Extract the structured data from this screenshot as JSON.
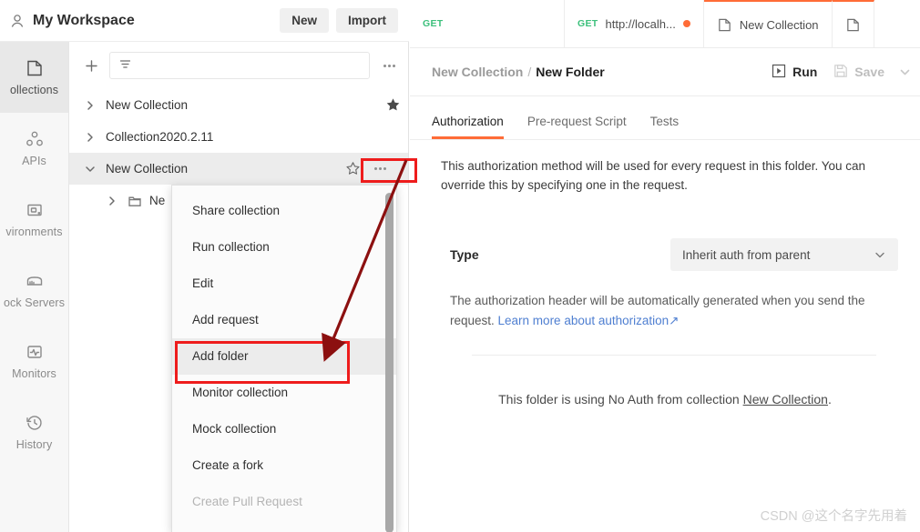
{
  "colors": {
    "accent": "#ff6c37",
    "verb_get": "#3dc07c",
    "annotation_red": "#ee1c1c",
    "arrow_dark_red": "#8c1010",
    "link_blue": "#4f7fd1"
  },
  "workspace_header": {
    "avatar_icon": "user-icon",
    "title": "My Workspace",
    "new_label": "New",
    "import_label": "Import"
  },
  "rail": {
    "items": [
      {
        "label": "ollections",
        "icon": "collections-icon",
        "active": true
      },
      {
        "label": "APIs",
        "icon": "apis-icon",
        "active": false
      },
      {
        "label": "vironments",
        "icon": "environments-icon",
        "active": false
      },
      {
        "label": "ock Servers",
        "icon": "mock-servers-icon",
        "active": false
      },
      {
        "label": "Monitors",
        "icon": "monitors-icon",
        "active": false
      },
      {
        "label": "History",
        "icon": "history-icon",
        "active": false
      }
    ]
  },
  "sidebar": {
    "add_icon": "plus-icon",
    "filter_icon": "filter-icon",
    "filter_value": "",
    "filter_placeholder": "",
    "more_icon": "more-horizontal-icon",
    "tree": [
      {
        "label": "New Collection",
        "expanded": false,
        "starred": true,
        "selected": false,
        "type": "collection"
      },
      {
        "label": "Collection2020.2.11",
        "expanded": false,
        "starred": false,
        "selected": false,
        "type": "collection"
      },
      {
        "label": "New Collection",
        "expanded": true,
        "starred": false,
        "selected": true,
        "type": "collection"
      },
      {
        "label": "Ne",
        "expanded": false,
        "starred": false,
        "selected": false,
        "type": "folder"
      }
    ]
  },
  "context_menu": {
    "items": [
      {
        "label": "Share collection",
        "state": "normal"
      },
      {
        "label": "Run collection",
        "state": "normal"
      },
      {
        "label": "Edit",
        "state": "normal"
      },
      {
        "label": "Add request",
        "state": "normal"
      },
      {
        "label": "Add folder",
        "state": "hover"
      },
      {
        "label": "Monitor collection",
        "state": "normal"
      },
      {
        "label": "Mock collection",
        "state": "normal"
      },
      {
        "label": "Create a fork",
        "state": "normal"
      },
      {
        "label": "Create Pull Request",
        "state": "disabled"
      }
    ]
  },
  "main": {
    "tabs": [
      {
        "verb": "GET",
        "name": "",
        "dirty": false,
        "icon": "",
        "active": false
      },
      {
        "verb": "GET",
        "name": "http://localh...",
        "dirty": true,
        "icon": "",
        "active": false
      },
      {
        "verb": "",
        "name": "New Collection",
        "dirty": false,
        "icon": "collection-icon",
        "active": true
      },
      {
        "verb": "",
        "name": "",
        "dirty": false,
        "icon": "collection-icon",
        "active": true
      }
    ],
    "breadcrumb": {
      "parent": "New Collection",
      "separator": "/",
      "current": "New Folder"
    },
    "run_label": "Run",
    "run_icon": "play-icon",
    "save_label": "Save",
    "save_icon": "save-icon",
    "more_icon": "chevron-down-icon",
    "subtabs": [
      {
        "label": "Authorization",
        "active": true
      },
      {
        "label": "Pre-request Script",
        "active": false
      },
      {
        "label": "Tests",
        "active": false
      }
    ],
    "auth": {
      "note": "This authorization method will be used for every request in this folder. You can override this by specifying one in the request.",
      "type_label": "Type",
      "type_value": "Inherit auth from parent",
      "type_caret_icon": "chevron-down-icon",
      "description_prefix": "The authorization header will be automatically generated when you send the request. ",
      "description_link": "Learn more about authorization",
      "description_link_icon": "↗",
      "inherit_prefix": "This folder is using No Auth from collection ",
      "inherit_link": "New Collection",
      "inherit_suffix": "."
    }
  },
  "watermark": "CSDN @这个名字先用着"
}
